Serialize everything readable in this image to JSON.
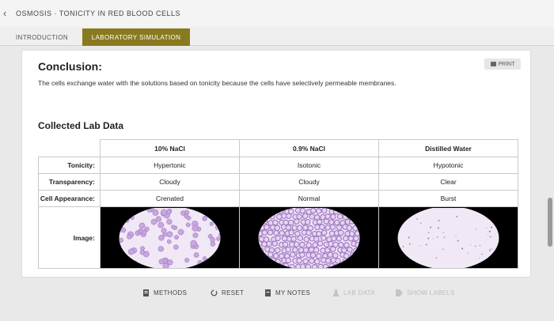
{
  "app": {
    "title": "OSMOSIS · TONICITY IN RED BLOOD CELLS"
  },
  "tabs": [
    {
      "label": "INTRODUCTION",
      "active": false
    },
    {
      "label": "LABORATORY SIMULATION",
      "active": true
    }
  ],
  "conclusion": {
    "title": "Conclusion:",
    "text": "The cells exchange water with the solutions based on tonicity because the cells have selectively permeable membranes.",
    "print_label": "PRINT"
  },
  "lab_data": {
    "title": "Collected Lab Data",
    "columns": [
      "10% NaCl",
      "0.9% NaCl",
      "Distilled Water"
    ],
    "rows": [
      {
        "label": "Tonicity:",
        "values": [
          "Hypertonic",
          "Isotonic",
          "Hypotonic"
        ]
      },
      {
        "label": "Transparency:",
        "values": [
          "Cloudy",
          "Cloudy",
          "Clear"
        ]
      },
      {
        "label": "Cell Appearance:",
        "values": [
          "Crenated",
          "Normal",
          "Burst"
        ]
      }
    ],
    "image_row_label": "Image:",
    "images": [
      {
        "icon": "crenated-cells-micrograph"
      },
      {
        "icon": "normal-cells-micrograph"
      },
      {
        "icon": "burst-cells-micrograph"
      }
    ]
  },
  "toolbar": {
    "methods": "METHODS",
    "reset": "RESET",
    "my_notes": "MY NOTES",
    "lab_data": "LAB DATA",
    "show_labels": "SHOW LABELS"
  },
  "colors": {
    "active_tab": "#8a7a1f",
    "cell_fill": "#c9a8de",
    "cell_edge": "#a27cc4",
    "micro_bg": "#f1e8f6"
  }
}
